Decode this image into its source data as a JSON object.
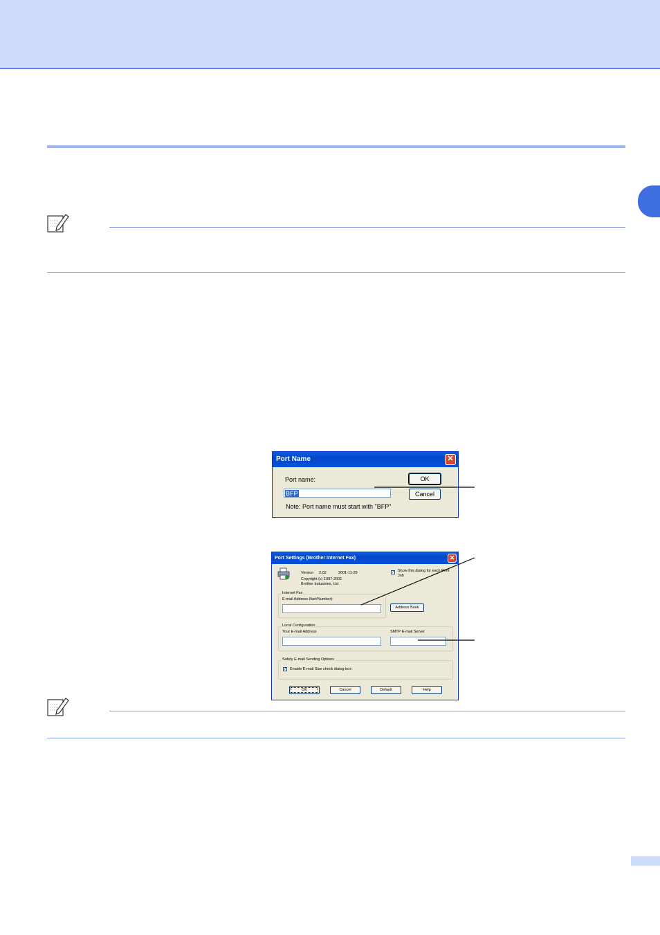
{
  "port_name_dialog": {
    "title": "Port Name",
    "port_name_label": "Port name:",
    "port_name_value": "BFP",
    "ok_label": "OK",
    "cancel_label": "Cancel",
    "note": "Note: Port name must start with \"BFP\""
  },
  "port_settings_dialog": {
    "title": "Port Settings (Brother Internet Fax)",
    "version_label": "Version",
    "version_value": "2.02",
    "date": "2001-11-29",
    "copyright": "Copyright (c) 1997-2001",
    "company": "Brother Industries, Ltd.",
    "show_dialog_label": "Show this dialog for each Print Job",
    "show_dialog_checked": "✓",
    "internet_fax_group": "Internet Fax",
    "email_address_label": "E-mail Address (fax#Number):",
    "address_book_label": "Address Book",
    "local_config_group": "Local Configuration",
    "your_email_label": "Your E-mail Address",
    "smtp_label": "SMTP E-mail Server",
    "safety_group": "Safety E-mail Sending Options",
    "enable_size_label": "Enable E-mail Size check dialog box",
    "enable_size_checked": "✓",
    "ok_label": "OK",
    "cancel_label": "Cancel",
    "default_label": "Default",
    "help_label": "Help"
  },
  "colors": {
    "header_band": "#cfdcfb",
    "accent": "#3f6ee0",
    "rule": "#9db4ef"
  },
  "icons": [
    "note-pencil-icon",
    "printer-icon",
    "close-icon",
    "check-icon"
  ]
}
